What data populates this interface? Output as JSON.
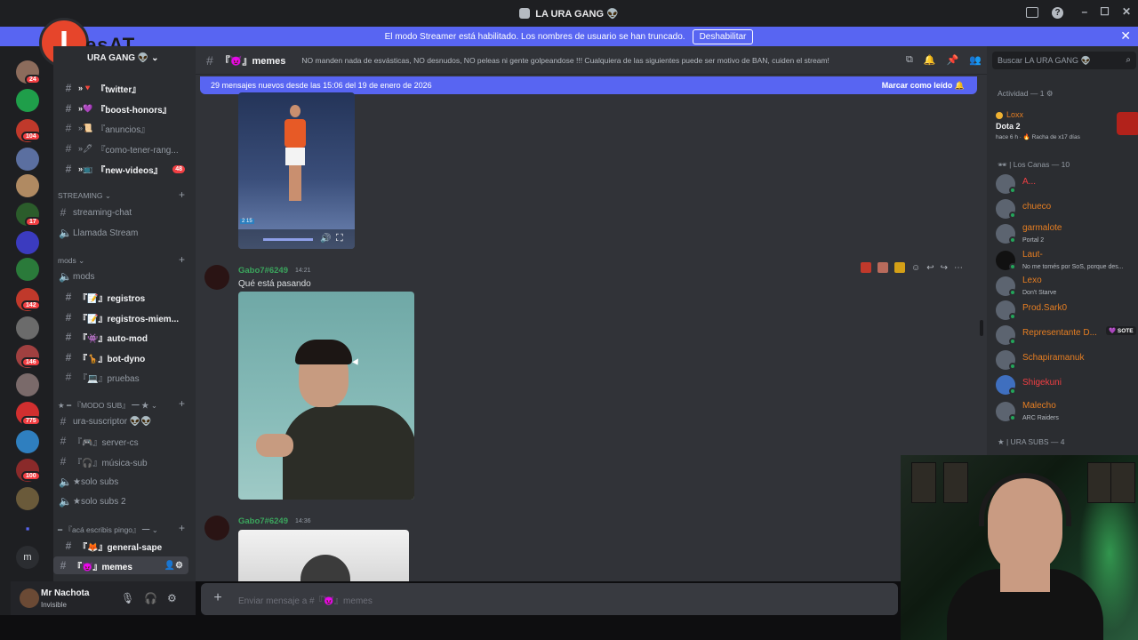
{
  "window": {
    "title": "LA URA GANG 👽"
  },
  "banner": {
    "text": "El modo Streamer está habilitado. Los nombres de usuario se han truncado.",
    "button": "Deshabilitar"
  },
  "overlay_logo": {
    "letter": "I",
    "text": "esAT"
  },
  "server": {
    "name": "URA GANG 👽"
  },
  "server_badges": [
    "24",
    "104",
    "17",
    "142",
    "146",
    "775",
    "100"
  ],
  "channels": [
    {
      "name": "『twitter』",
      "emoji": "»🔻",
      "unread": true
    },
    {
      "name": "『boost-honors』",
      "emoji": "»💜",
      "unread": true
    },
    {
      "name": "『anuncios』",
      "emoji": "»📜",
      "unread": false
    },
    {
      "name": "『como-tener-rang...",
      "emoji": "»🖊",
      "unread": false
    },
    {
      "name": "『new-videos』",
      "emoji": "»📺",
      "unread": true,
      "mentions": "48"
    }
  ],
  "categories": {
    "streaming": "STREAMING",
    "mods": "mods",
    "modo_sub": "『MODO SUB』",
    "aca": "『acá escribis pingo』"
  },
  "streaming_channels": [
    "streaming-chat",
    "Llamada Stream"
  ],
  "mods_channels": [
    "mods",
    "『📝』registros",
    "『📝』registros-miem...",
    "『👾』auto-mod",
    "『🦒』bot-dyno",
    "『💻』pruebas"
  ],
  "sub_channels": [
    "ura-suscriptor 👽👽",
    "『🎮』server-cs",
    "『🎧』música-sub",
    "solo subs",
    "solo subs 2"
  ],
  "aca_channels": [
    "『🦊』general-sape",
    "『😈』memes"
  ],
  "user": {
    "name": "Mr Nachota",
    "status": "Invisible"
  },
  "header": {
    "channel": "『😈』memes",
    "topic": "NO manden nada de esvásticas, NO desnudos, NO peleas ni gente golpeandose !!! Cualquiera de las siguientes puede ser motivo de BAN, cuiden el stream!"
  },
  "new_messages": {
    "text": "29 mensajes nuevos desde las 15:06 del 19 de enero de 2026",
    "action": "Marcar como leído"
  },
  "messages": [
    {
      "author": "Gabo7#6249",
      "time": "14:21",
      "text": "Qué está pasando"
    },
    {
      "author": "Gabo7#6249",
      "time": "14:36",
      "text": ""
    }
  ],
  "video": {
    "overlay": "2 15"
  },
  "composer": {
    "placeholder": "Enviar mensaje a #『😈』memes"
  },
  "search": {
    "placeholder": "Buscar LA URA GANG 👽"
  },
  "members": {
    "activity_header": "Actividad — 1",
    "activity": {
      "name": "Loxx",
      "game": "Dota 2",
      "detail": "hace 6 h · 🔥 Racha de x17 días"
    },
    "group1": "Los Canas — 10",
    "list": [
      {
        "name": "A...",
        "sub": "",
        "color": "#f23f43"
      },
      {
        "name": "chueco",
        "sub": "",
        "color": "#e67e22"
      },
      {
        "name": "garmalote",
        "sub": "Portal 2",
        "color": "#e67e22"
      },
      {
        "name": "Laut-",
        "sub": "No me tomés por SoS, porque des...",
        "color": "#e67e22"
      },
      {
        "name": "Lexo",
        "sub": "Don't Starve",
        "color": "#e67e22"
      },
      {
        "name": "Prod.Sark0",
        "sub": "",
        "color": "#e67e22"
      },
      {
        "name": "Representante D...",
        "sub": "",
        "color": "#e67e22",
        "tag": "SOTE"
      },
      {
        "name": "Schapiramanuk",
        "sub": "",
        "color": "#e67e22"
      },
      {
        "name": "Shigekuni",
        "sub": "",
        "color": "#f23f43"
      },
      {
        "name": "Malecho",
        "sub": "ARC Raiders",
        "color": "#e67e22"
      }
    ],
    "group2": "| URA SUBS — 4"
  },
  "colors": {
    "accent": "#5865f2",
    "online": "#23a55a",
    "author": "#3ba55d",
    "danger": "#f23f43"
  }
}
